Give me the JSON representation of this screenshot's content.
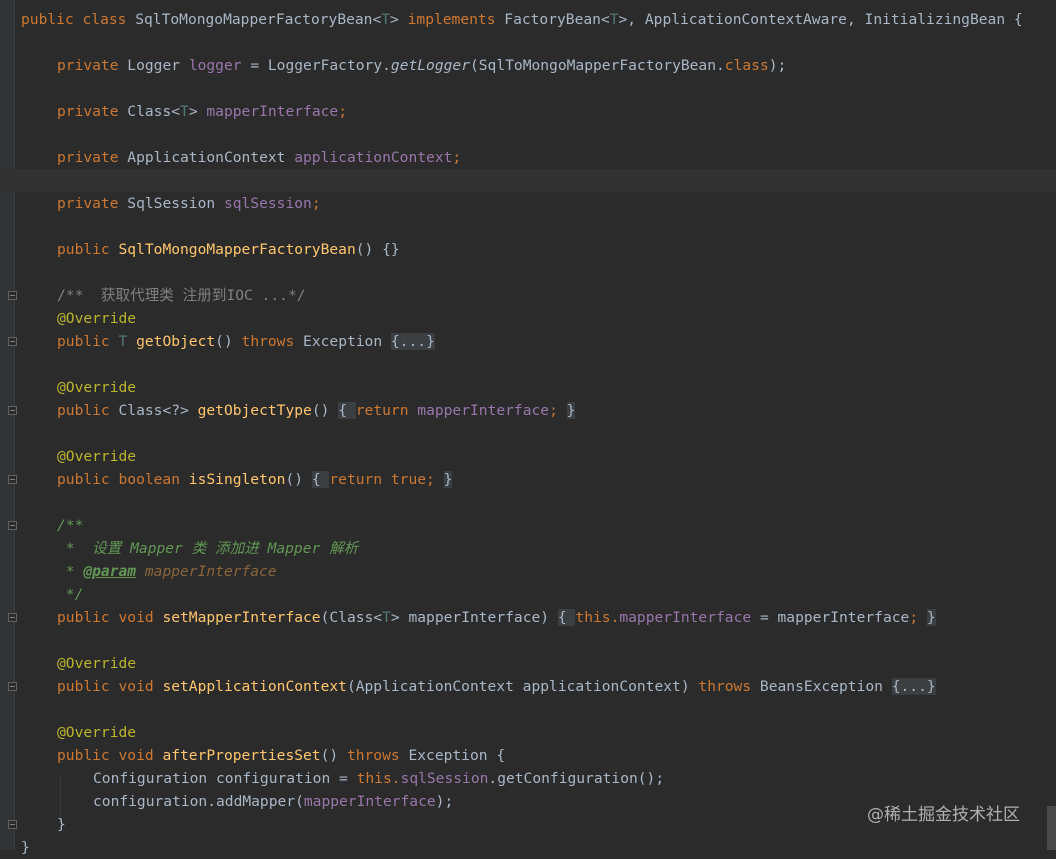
{
  "editor": {
    "colors": {
      "background": "#2b2b2b",
      "keyword": "#cc7832",
      "type_param": "#507874",
      "field": "#9876aa",
      "method": "#ffc66d",
      "annotation": "#bbb529",
      "doc_comment": "#629755",
      "comment": "#808080",
      "plain": "#a9b7c6"
    },
    "lines": [
      [
        [
          "kw",
          "public class "
        ],
        [
          "pl",
          "SqlToMongoMapperFactoryBean<"
        ],
        [
          "tp",
          "T"
        ],
        [
          "pl",
          "> "
        ],
        [
          "kw",
          "implements "
        ],
        [
          "pl",
          "FactoryBean<"
        ],
        [
          "tp",
          "T"
        ],
        [
          "pl",
          ">, ApplicationContextAware, InitializingBean {"
        ]
      ],
      [
        [
          "kw",
          "private "
        ],
        [
          "pl",
          "Logger "
        ],
        [
          "fld",
          "logger"
        ],
        [
          "pl",
          " = LoggerFactory."
        ],
        [
          "it",
          "getLogger"
        ],
        [
          "pl",
          "(SqlToMongoMapperFactoryBean."
        ],
        [
          "kw",
          "class"
        ],
        [
          "pl",
          ");"
        ]
      ],
      [
        [
          "kw",
          "private "
        ],
        [
          "pl",
          "Class<"
        ],
        [
          "tp",
          "T"
        ],
        [
          "pl",
          "> "
        ],
        [
          "fld",
          "mapperInterface"
        ],
        [
          "kw",
          ";"
        ]
      ],
      [
        [
          "kw",
          "private "
        ],
        [
          "pl",
          "ApplicationContext "
        ],
        [
          "fld",
          "applicationContext"
        ],
        [
          "kw",
          ";"
        ]
      ],
      [
        [
          "kw",
          "private "
        ],
        [
          "pl",
          "SqlSession "
        ],
        [
          "fld",
          "sqlSession"
        ],
        [
          "kw",
          ";"
        ]
      ],
      [
        [
          "kw",
          "public "
        ],
        [
          "fn",
          "SqlToMongoMapperFactoryBean"
        ],
        [
          "pl",
          "() {}"
        ]
      ],
      [
        [
          "cm",
          "/**  获取代理类 注册到IOC ...*/"
        ]
      ],
      [
        [
          "ann",
          "@Override"
        ]
      ],
      [
        [
          "kw",
          "public "
        ],
        [
          "tp",
          "T "
        ],
        [
          "fn",
          "getObject"
        ],
        [
          "pl",
          "() "
        ],
        [
          "kw",
          "throws "
        ],
        [
          "pl",
          "Exception "
        ],
        [
          "fc",
          "{...}"
        ]
      ],
      [
        [
          "ann",
          "@Override"
        ]
      ],
      [
        [
          "kw",
          "public "
        ],
        [
          "pl",
          "Class<?> "
        ],
        [
          "fn",
          "getObjectType"
        ],
        [
          "pl",
          "() "
        ],
        [
          "fc",
          "{ "
        ],
        [
          "kw",
          "return "
        ],
        [
          "fld",
          "mapperInterface"
        ],
        [
          "kw",
          "; "
        ],
        [
          "fc",
          "}"
        ]
      ],
      [
        [
          "ann",
          "@Override"
        ]
      ],
      [
        [
          "kw",
          "public boolean "
        ],
        [
          "fn",
          "isSingleton"
        ],
        [
          "pl",
          "() "
        ],
        [
          "fc",
          "{ "
        ],
        [
          "kw",
          "return true; "
        ],
        [
          "fc",
          "}"
        ]
      ],
      [
        [
          "dc",
          "/**"
        ]
      ],
      [
        [
          "dc",
          " *  设置 Mapper 类 添加进 Mapper 解析"
        ]
      ],
      [
        [
          "dc",
          " * "
        ],
        [
          "dcb",
          "@param"
        ],
        [
          "dc",
          " "
        ],
        [
          "dcv",
          "mapperInterface"
        ]
      ],
      [
        [
          "dc",
          " */"
        ]
      ],
      [
        [
          "kw",
          "public void "
        ],
        [
          "fn",
          "setMapperInterface"
        ],
        [
          "pl",
          "(Class<"
        ],
        [
          "tp",
          "T"
        ],
        [
          "pl",
          "> mapperInterface) "
        ],
        [
          "fc",
          "{ "
        ],
        [
          "kw",
          "this."
        ],
        [
          "fld",
          "mapperInterface"
        ],
        [
          "pl",
          " = mapperInterface"
        ],
        [
          "kw",
          "; "
        ],
        [
          "fc",
          "}"
        ]
      ],
      [
        [
          "ann",
          "@Override"
        ]
      ],
      [
        [
          "kw",
          "public void "
        ],
        [
          "fn",
          "setApplicationContext"
        ],
        [
          "pl",
          "(ApplicationContext applicationContext) "
        ],
        [
          "kw",
          "throws "
        ],
        [
          "pl",
          "BeansException "
        ],
        [
          "fc",
          "{...}"
        ]
      ],
      [
        [
          "ann",
          "@Override"
        ]
      ],
      [
        [
          "kw",
          "public void "
        ],
        [
          "fn",
          "afterPropertiesSet"
        ],
        [
          "pl",
          "() "
        ],
        [
          "kw",
          "throws "
        ],
        [
          "pl",
          "Exception {"
        ]
      ],
      [
        [
          "pl",
          "Configuration configuration = "
        ],
        [
          "kw",
          "this."
        ],
        [
          "fld",
          "sqlSession"
        ],
        [
          "pl",
          ".getConfiguration();"
        ]
      ],
      [
        [
          "pl",
          "configuration.addMapper("
        ],
        [
          "fld",
          "mapperInterface"
        ],
        [
          "pl",
          ");"
        ]
      ],
      [
        [
          "pl",
          "}"
        ]
      ],
      [
        [
          "pl",
          "}"
        ]
      ]
    ]
  },
  "watermark": "@稀土掘金技术社区"
}
